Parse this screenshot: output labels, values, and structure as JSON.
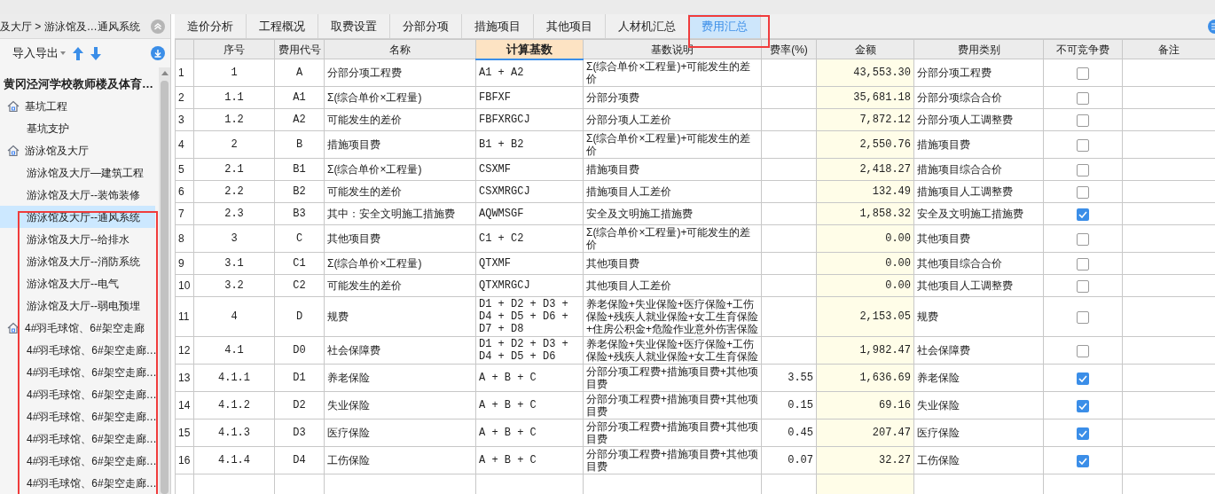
{
  "breadcrumb": {
    "text": "及大厅 > 游泳馆及…通风系统"
  },
  "toolbar": {
    "import_export": "导入导出"
  },
  "tree": {
    "root": "黄冈泾河学校教师楼及体育…",
    "items": [
      {
        "label": "基坑工程",
        "selected": false,
        "children": [
          {
            "label": "基坑支护",
            "selected": false
          }
        ]
      },
      {
        "label": "游泳馆及大厅",
        "selected": false,
        "children": [
          {
            "label": "游泳馆及大厅—建筑工程",
            "selected": false
          },
          {
            "label": "游泳馆及大厅--装饰装修",
            "selected": false
          },
          {
            "label": "游泳馆及大厅--通风系统",
            "selected": true
          },
          {
            "label": "游泳馆及大厅--给排水",
            "selected": false
          },
          {
            "label": "游泳馆及大厅--消防系统",
            "selected": false
          },
          {
            "label": "游泳馆及大厅--电气",
            "selected": false
          },
          {
            "label": "游泳馆及大厅--弱电预埋",
            "selected": false
          }
        ]
      },
      {
        "label": "4#羽毛球馆、6#架空走廊",
        "selected": false,
        "children": [
          {
            "label": "4#羽毛球馆、6#架空走廊…",
            "selected": false
          },
          {
            "label": "4#羽毛球馆、6#架空走廊…",
            "selected": false
          },
          {
            "label": "4#羽毛球馆、6#架空走廊…",
            "selected": false
          },
          {
            "label": "4#羽毛球馆、6#架空走廊…",
            "selected": false
          },
          {
            "label": "4#羽毛球馆、6#架空走廊…",
            "selected": false
          },
          {
            "label": "4#羽毛球馆、6#架空走廊…",
            "selected": false
          },
          {
            "label": "4#羽毛球馆、6#架空走廊…",
            "selected": false
          }
        ]
      }
    ]
  },
  "tabs": [
    {
      "label": "造价分析",
      "selected": false
    },
    {
      "label": "工程概况",
      "selected": false
    },
    {
      "label": "取费设置",
      "selected": false
    },
    {
      "label": "分部分项",
      "selected": false
    },
    {
      "label": "措施项目",
      "selected": false
    },
    {
      "label": "其他项目",
      "selected": false
    },
    {
      "label": "人材机汇总",
      "selected": false
    },
    {
      "label": "费用汇总",
      "selected": true
    }
  ],
  "table": {
    "columns": [
      {
        "selected": false
      },
      {
        "label": "序号",
        "selected": false
      },
      {
        "label": "费用代号",
        "selected": false
      },
      {
        "label": "名称",
        "selected": false
      },
      {
        "label": "计算基数",
        "selected": true
      },
      {
        "label": "基数说明",
        "selected": false
      },
      {
        "label": "费率(%)",
        "selected": false
      },
      {
        "label": "金额",
        "selected": false
      },
      {
        "label": "费用类别",
        "selected": false
      },
      {
        "label": "不可竞争费",
        "selected": false
      },
      {
        "label": "备注",
        "selected": false
      }
    ],
    "rows": [
      {
        "n": "1",
        "seq": "1",
        "code": "A",
        "name": "分部分项工程费",
        "base": "A1 + A2",
        "desc": "Σ(综合单价×工程量)+可能发生的差价",
        "rate": "",
        "amount": "43,553.30",
        "category": "分部分项工程费",
        "checked": false
      },
      {
        "n": "2",
        "seq": "1.1",
        "code": "A1",
        "name": "Σ(综合单价×工程量)",
        "base": "FBFXF",
        "desc": "分部分项费",
        "rate": "",
        "amount": "35,681.18",
        "category": "分部分项综合合价",
        "checked": false
      },
      {
        "n": "3",
        "seq": "1.2",
        "code": "A2",
        "name": "可能发生的差价",
        "base": "FBFXRGCJ",
        "desc": "分部分项人工差价",
        "rate": "",
        "amount": "7,872.12",
        "category": "分部分项人工调整费",
        "checked": false
      },
      {
        "n": "4",
        "seq": "2",
        "code": "B",
        "name": "措施项目费",
        "base": "B1 + B2",
        "desc": "Σ(综合单价×工程量)+可能发生的差价",
        "rate": "",
        "amount": "2,550.76",
        "category": "措施项目费",
        "checked": false
      },
      {
        "n": "5",
        "seq": "2.1",
        "code": "B1",
        "name": "Σ(综合单价×工程量)",
        "base": "CSXMF",
        "desc": "措施项目费",
        "rate": "",
        "amount": "2,418.27",
        "category": "措施项目综合合价",
        "checked": false
      },
      {
        "n": "6",
        "seq": "2.2",
        "code": "B2",
        "name": "可能发生的差价",
        "base": "CSXMRGCJ",
        "desc": "措施项目人工差价",
        "rate": "",
        "amount": "132.49",
        "category": "措施项目人工调整费",
        "checked": false
      },
      {
        "n": "7",
        "seq": "2.3",
        "code": "B3",
        "name": "其中：安全文明施工措施费",
        "base": "AQWMSGF",
        "desc": "安全及文明施工措施费",
        "rate": "",
        "amount": "1,858.32",
        "category": "安全及文明施工措施费",
        "checked": true
      },
      {
        "n": "8",
        "seq": "3",
        "code": "C",
        "name": "其他项目费",
        "base": "C1 + C2",
        "desc": "Σ(综合单价×工程量)+可能发生的差价",
        "rate": "",
        "amount": "0.00",
        "category": "其他项目费",
        "checked": false
      },
      {
        "n": "9",
        "seq": "3.1",
        "code": "C1",
        "name": "Σ(综合单价×工程量)",
        "base": "QTXMF",
        "desc": "其他项目费",
        "rate": "",
        "amount": "0.00",
        "category": "其他项目综合合价",
        "checked": false
      },
      {
        "n": "10",
        "seq": "3.2",
        "code": "C2",
        "name": "可能发生的差价",
        "base": "QTXMRGCJ",
        "desc": "其他项目人工差价",
        "rate": "",
        "amount": "0.00",
        "category": "其他项目人工调整费",
        "checked": false
      },
      {
        "n": "11",
        "seq": "4",
        "code": "D",
        "name": "规费",
        "base": "D1 + D2 + D3 + D4 + D5 + D6 + D7 + D8",
        "desc": "养老保险+失业保险+医疗保险+工伤保险+残疾人就业保险+女工生育保险+住房公积金+危险作业意外伤害保险",
        "rate": "",
        "amount": "2,153.05",
        "category": "规费",
        "checked": false
      },
      {
        "n": "12",
        "seq": "4.1",
        "code": "D0",
        "name": "社会保障费",
        "base": "D1 + D2 + D3 + D4 + D5 + D6",
        "desc": "养老保险+失业保险+医疗保险+工伤保险+残疾人就业保险+女工生育保险",
        "rate": "",
        "amount": "1,982.47",
        "category": "社会保障费",
        "checked": false
      },
      {
        "n": "13",
        "seq": "4.1.1",
        "code": "D1",
        "name": "养老保险",
        "base": "A + B + C",
        "desc": "分部分项工程费+措施项目费+其他项目费",
        "rate": "3.55",
        "amount": "1,636.69",
        "category": "养老保险",
        "checked": true
      },
      {
        "n": "14",
        "seq": "4.1.2",
        "code": "D2",
        "name": "失业保险",
        "base": "A + B + C",
        "desc": "分部分项工程费+措施项目费+其他项目费",
        "rate": "0.15",
        "amount": "69.16",
        "category": "失业保险",
        "checked": true
      },
      {
        "n": "15",
        "seq": "4.1.3",
        "code": "D3",
        "name": "医疗保险",
        "base": "A + B + C",
        "desc": "分部分项工程费+措施项目费+其他项目费",
        "rate": "0.45",
        "amount": "207.47",
        "category": "医疗保险",
        "checked": true
      },
      {
        "n": "16",
        "seq": "4.1.4",
        "code": "D4",
        "name": "工伤保险",
        "base": "A + B + C",
        "desc": "分部分项工程费+措施项目费+其他项目费",
        "rate": "0.07",
        "amount": "32.27",
        "category": "工伤保险",
        "checked": true
      }
    ]
  }
}
